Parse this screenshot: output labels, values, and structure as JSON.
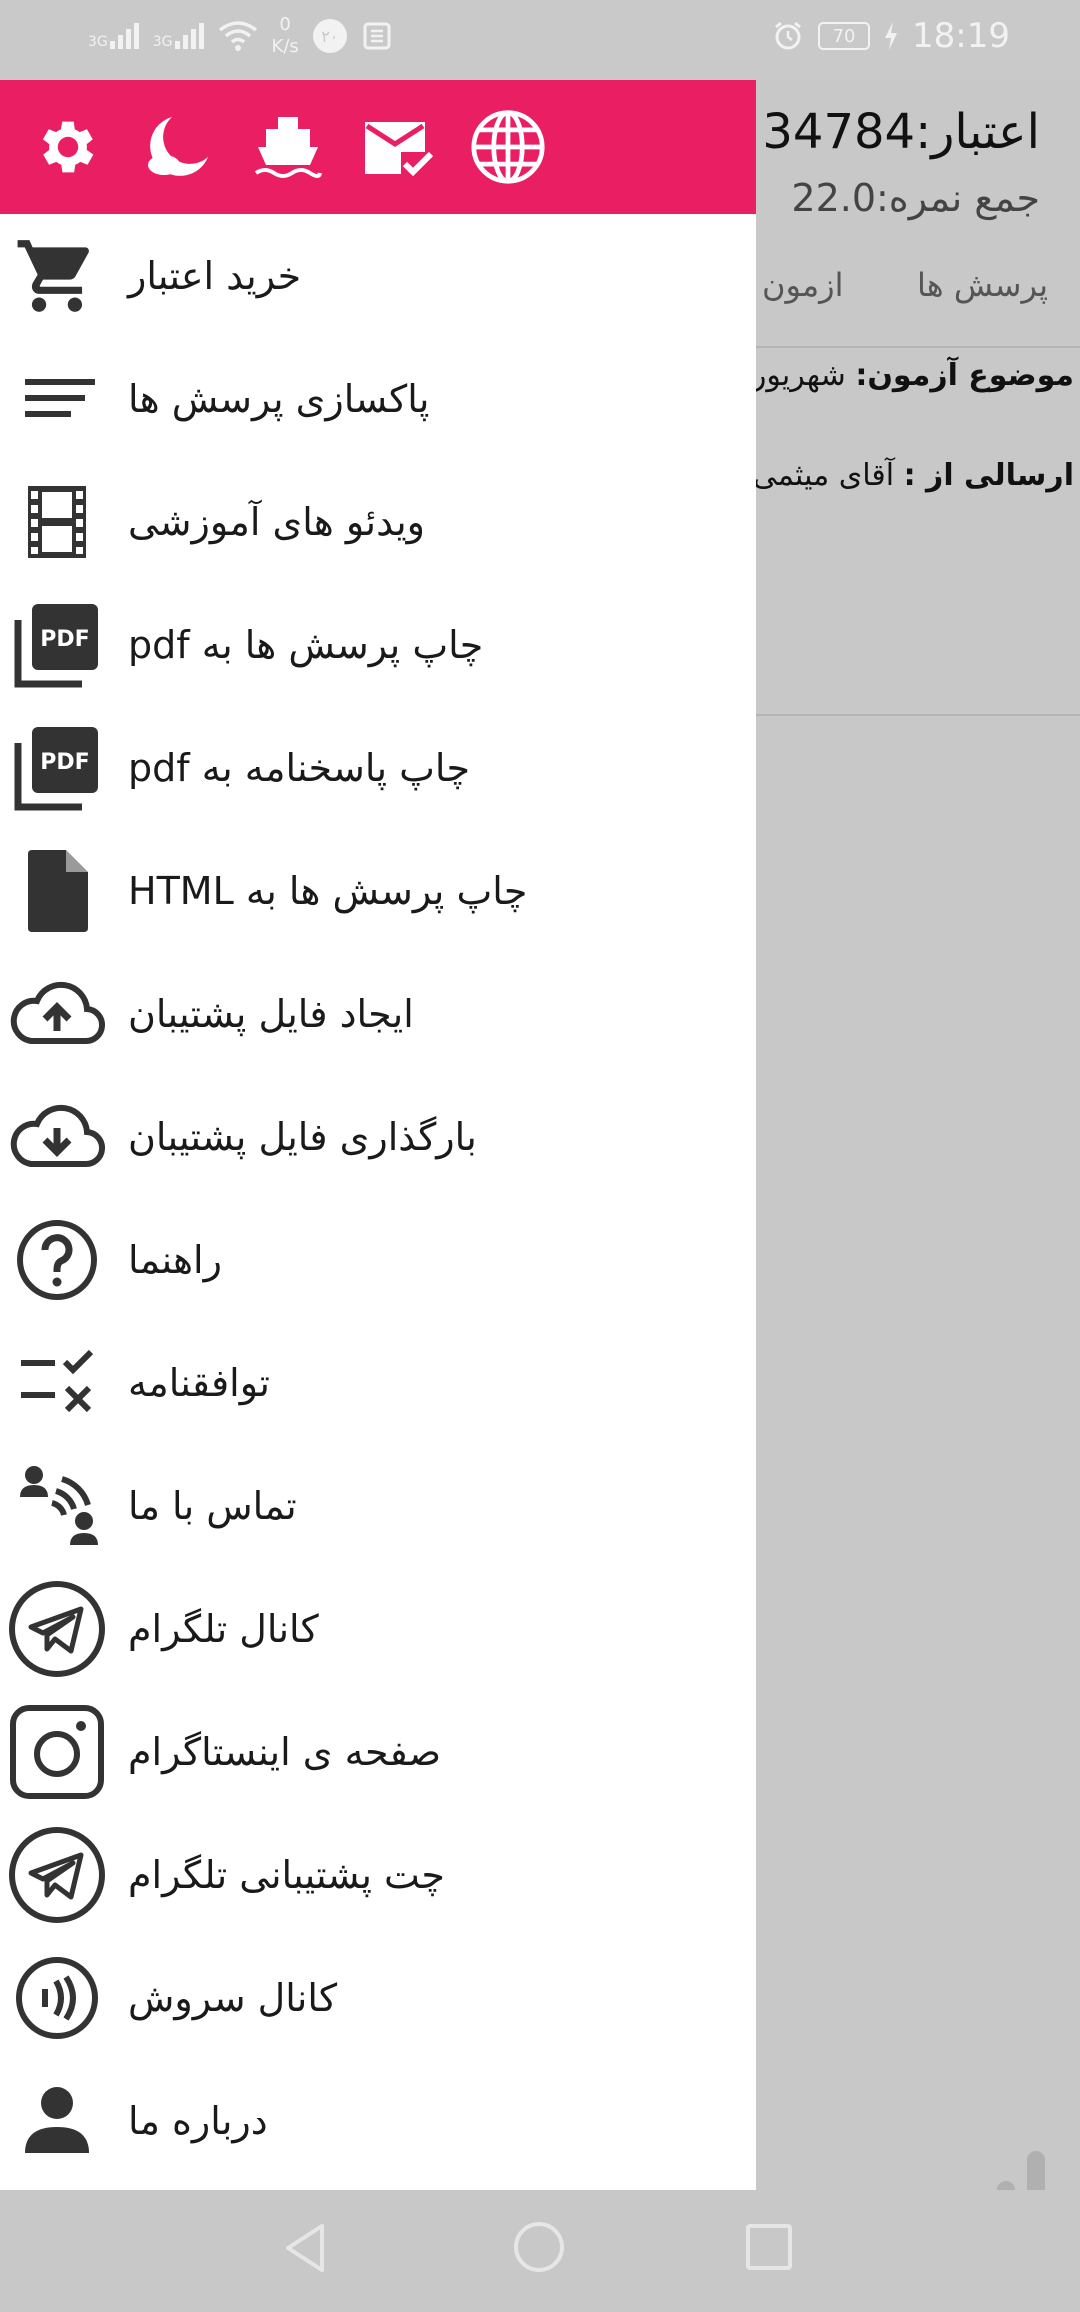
{
  "status_bar": {
    "net1": "3G",
    "net2": "3G",
    "speed_value": "0",
    "speed_unit": "K/s",
    "notif_badge": "۲۰",
    "battery": "70",
    "time": "18:19"
  },
  "background_app": {
    "credit": "اعتبار:34784",
    "score": "جمع نمره:22.0",
    "tab_questions": "پرسش ها",
    "tab_exam": "ازمون",
    "topic_label": "موضوع آزمون:",
    "topic_value": "شهریور",
    "sender_label": "ارسالی از :",
    "sender_value": "آقای میثمی"
  },
  "drawer": {
    "header_color": "#e91e63",
    "header_icons": [
      "settings-icon",
      "night-mode-icon",
      "ship-icon",
      "mail-check-icon",
      "globe-icon"
    ],
    "items": [
      {
        "icon": "cart-icon",
        "label": "خرید اعتبار"
      },
      {
        "icon": "clear-list-icon",
        "label": "پاکسازی پرسش ها"
      },
      {
        "icon": "film-icon",
        "label": "ویدئو های آموزشی"
      },
      {
        "icon": "pdf-icon",
        "label": "چاپ پرسش ها به pdf"
      },
      {
        "icon": "pdf-icon",
        "label": "چاپ پاسخنامه به pdf"
      },
      {
        "icon": "file-icon",
        "label": "چاپ پرسش ها به HTML"
      },
      {
        "icon": "cloud-upload-icon",
        "label": "ایجاد فایل پشتیبان"
      },
      {
        "icon": "cloud-download-icon",
        "label": "بارگذاری فایل پشتیبان"
      },
      {
        "icon": "help-icon",
        "label": "راهنما"
      },
      {
        "icon": "rules-icon",
        "label": "توافقنامه"
      },
      {
        "icon": "contact-icon",
        "label": "تماس با ما"
      },
      {
        "icon": "telegram-icon",
        "label": "کانال تلگرام"
      },
      {
        "icon": "instagram-icon",
        "label": "صفحه ی اینستاگرام"
      },
      {
        "icon": "telegram-icon",
        "label": "چت پشتیبانی تلگرام"
      },
      {
        "icon": "soroush-icon",
        "label": "کانال سروش"
      },
      {
        "icon": "person-icon",
        "label": "درباره ما"
      }
    ]
  }
}
